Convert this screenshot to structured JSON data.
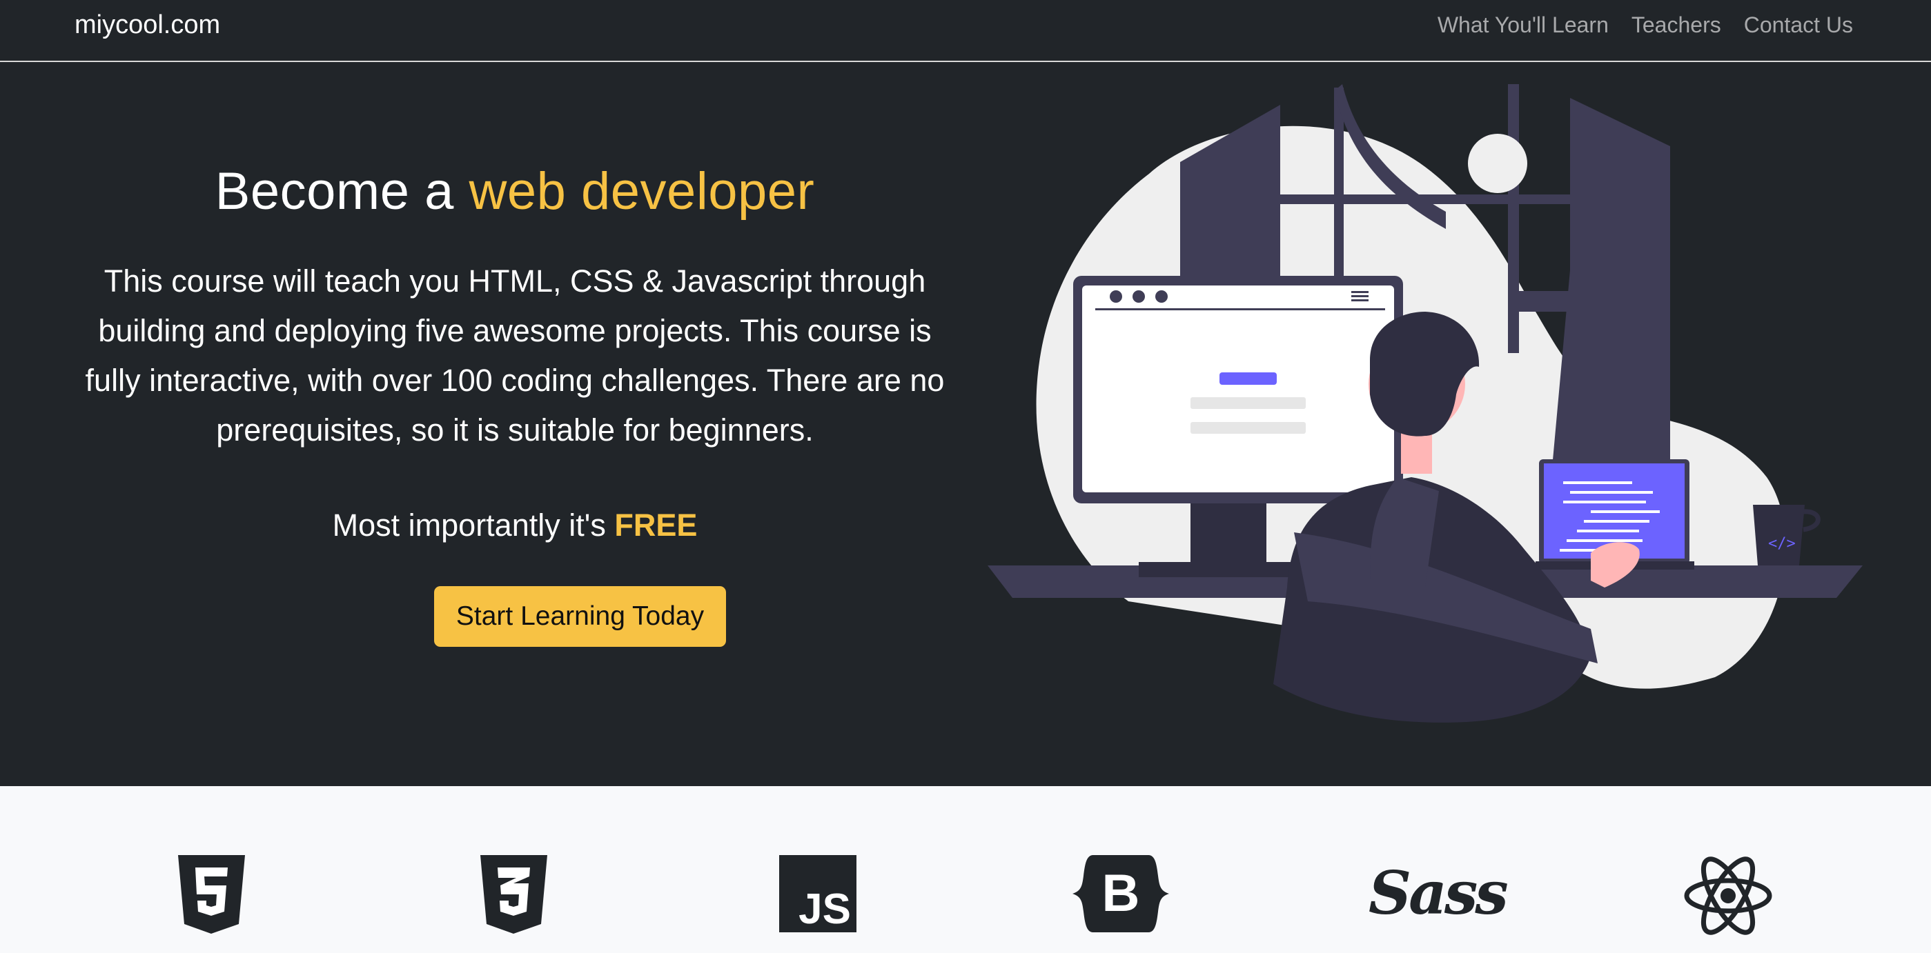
{
  "navbar": {
    "brand": "miycool.com",
    "links": [
      "What You'll Learn",
      "Teachers",
      "Contact Us"
    ]
  },
  "hero": {
    "title_prefix": "Become a ",
    "title_accent": "web developer",
    "description": "This course will teach you HTML, CSS & Javascript through building and deploying five awesome projects. This course is fully interactive, with over 100 coding challenges. There are no prerequisites, so it is suitable for beginners.",
    "free_prefix": "Most importantly it's ",
    "free_word": "FREE",
    "cta_label": "Start Learning Today"
  },
  "tech_icons": [
    "html5-icon",
    "css3-icon",
    "javascript-icon",
    "bootstrap-icon",
    "sass-icon",
    "react-icon"
  ],
  "js_label": "JS",
  "bootstrap_label": "B",
  "sass_label": "Sass",
  "colors": {
    "background": "#212529",
    "accent": "#f7c244",
    "strip": "#f8f9fb",
    "illustration_purple": "#6c63ff",
    "illustration_dark": "#3f3d56"
  }
}
